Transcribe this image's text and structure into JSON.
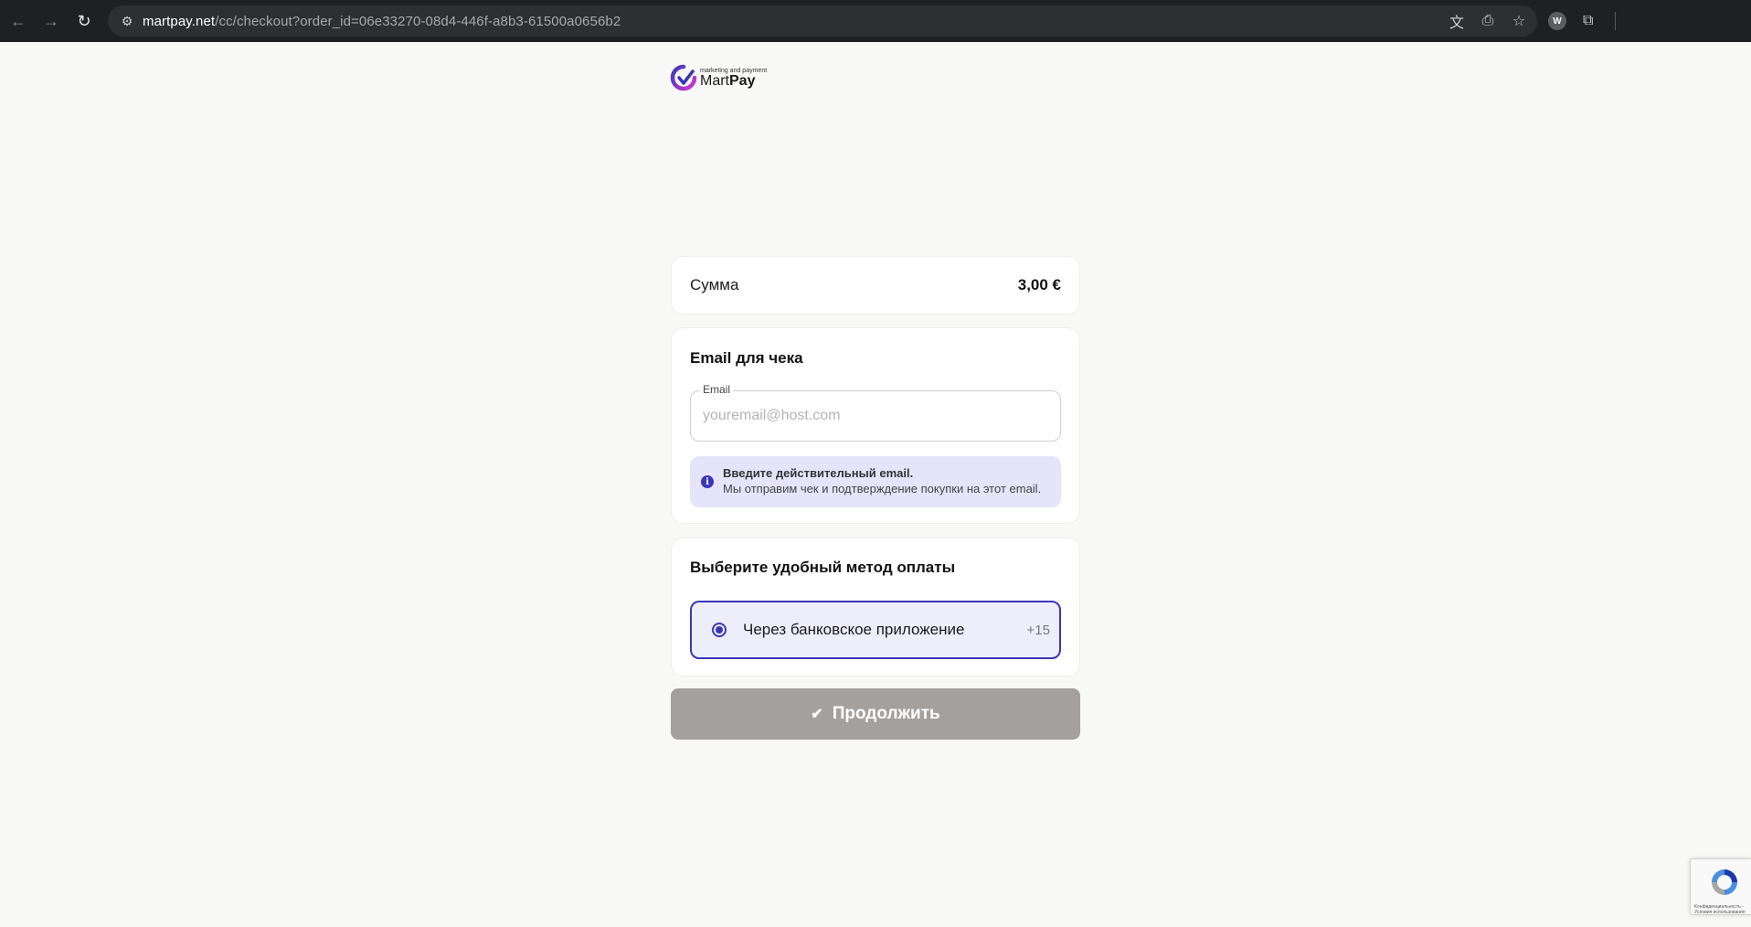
{
  "browser": {
    "url_host": "martpay.net",
    "url_path": "/cc/checkout?order_id=06e33270-08d4-446f-a8b3-61500a0656b2",
    "profile_initials": "W"
  },
  "logo": {
    "tagline": "marketing and payment",
    "name_regular": "Mart",
    "name_bold": "Pay",
    "colors": [
      "#3b36b8",
      "#d33ad0"
    ]
  },
  "summary": {
    "label": "Сумма",
    "value": "3,00 €"
  },
  "email_section": {
    "title": "Email для чека",
    "field_label": "Email",
    "placeholder": "youremail@host.com",
    "value": "",
    "info_title": "Введите действительный email.",
    "info_text": "Мы отправим чек и подтверждение покупки на этот email."
  },
  "payment_section": {
    "title": "Выберите удобный метод оплаты",
    "option_label": "Через банковское приложение",
    "option_more": "+15",
    "selected": true
  },
  "continue_button": {
    "label": "Продолжить"
  },
  "recaptcha": {
    "privacy": "Конфиденциальность -",
    "terms": "Условия использования"
  },
  "colors": {
    "accent": "#3b36b8",
    "accent_bg": "#eeedfc",
    "button_disabled": "#a3a09e"
  }
}
